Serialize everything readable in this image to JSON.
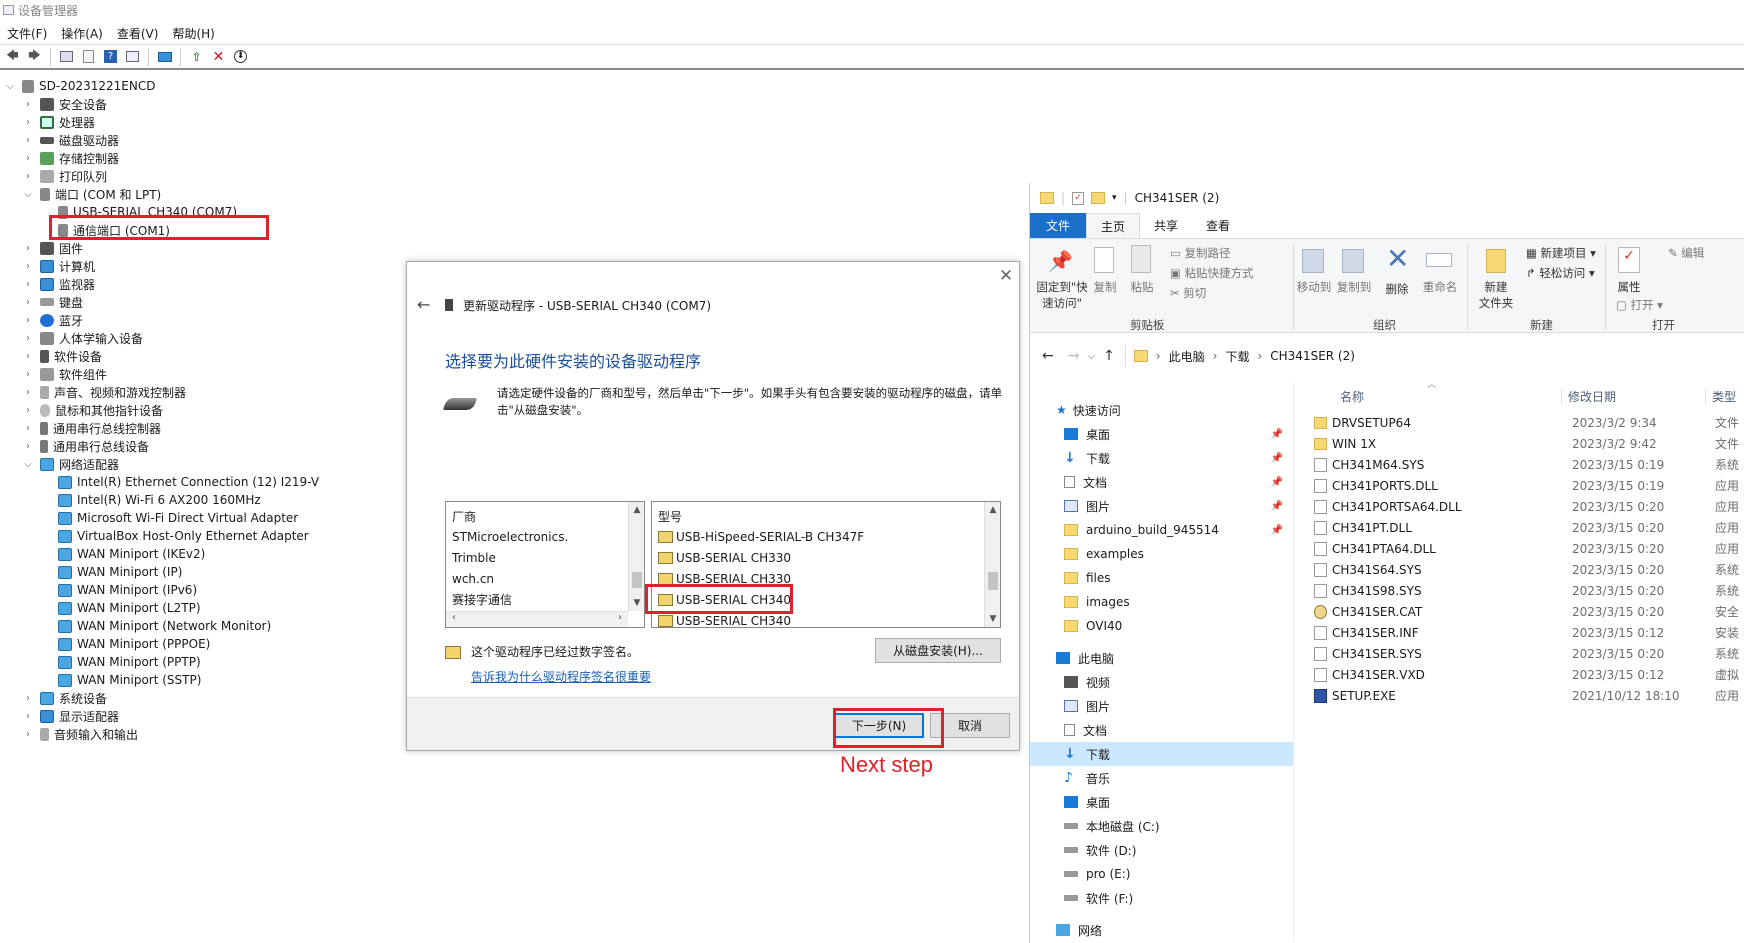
{
  "devmgr": {
    "title": "设备管理器",
    "menu": [
      "文件(F)",
      "操作(A)",
      "查看(V)",
      "帮助(H)"
    ],
    "root": "SD-20231221ENCD",
    "categories_top": [
      "安全设备",
      "处理器",
      "磁盘驱动器",
      "存储控制器",
      "打印队列"
    ],
    "ports_category": "端口 (COM 和 LPT)",
    "ports_children": [
      "USB-SERIAL CH340 (COM7)",
      "通信端口 (COM1)"
    ],
    "categories_mid": [
      "固件",
      "计算机",
      "监视器",
      "键盘",
      "蓝牙",
      "人体学输入设备",
      "软件设备",
      "软件组件",
      "声音、视频和游戏控制器",
      "鼠标和其他指针设备",
      "通用串行总线控制器",
      "通用串行总线设备"
    ],
    "network_category": "网络适配器",
    "network_children": [
      "Intel(R) Ethernet Connection (12) I219-V",
      "Intel(R) Wi-Fi 6 AX200 160MHz",
      "Microsoft Wi-Fi Direct Virtual Adapter",
      "VirtualBox Host-Only Ethernet Adapter",
      "WAN Miniport (IKEv2)",
      "WAN Miniport (IP)",
      "WAN Miniport (IPv6)",
      "WAN Miniport (L2TP)",
      "WAN Miniport (Network Monitor)",
      "WAN Miniport (PPPOE)",
      "WAN Miniport (PPTP)",
      "WAN Miniport (SSTP)"
    ],
    "categories_bottom": [
      "系统设备",
      "显示适配器",
      "音频输入和输出"
    ]
  },
  "dialog": {
    "caption": "更新驱动程序 - USB-SERIAL CH340 (COM7)",
    "heading": "选择要为此硬件安装的设备驱动程序",
    "description": "请选定硬件设备的厂商和型号，然后单击\"下一步\"。如果手头有包含要安装的驱动程序的磁盘，请单击\"从磁盘安装\"。",
    "manufacturer_header": "厂商",
    "manufacturers": [
      "STMicroelectronics.",
      "Trimble",
      "wch.cn",
      "赛接字通信"
    ],
    "model_header": "型号",
    "models": [
      "USB-HiSpeed-SERIAL-B CH347F",
      "USB-SERIAL CH330",
      "USB-SERIAL CH330",
      "USB-SERIAL CH340",
      "USB-SERIAL CH340"
    ],
    "signed_text": "这个驱动程序已经过数字签名。",
    "signing_link": "告诉我为什么驱动程序签名很重要",
    "have_disk": "从磁盘安装(H)...",
    "next": "下一步(N)",
    "cancel": "取消",
    "annotation": "Next step"
  },
  "explorer": {
    "title": "CH341SER (2)",
    "tabs": [
      "文件",
      "主页",
      "共享",
      "查看"
    ],
    "ribbon": {
      "pin": "固定到\"快\n速访问\"",
      "copy": "复制",
      "paste": "粘贴",
      "copy_path": "复制路径",
      "paste_shortcut": "粘贴快捷方式",
      "cut": "剪切",
      "group_clipboard": "剪贴板",
      "move_to": "移动到",
      "copy_to": "复制到",
      "delete": "删除",
      "rename": "重命名",
      "group_organize": "组织",
      "new_folder": "新建\n文件夹",
      "new_item": "新建项目",
      "easy_access": "轻松访问",
      "group_new": "新建",
      "properties": "属性",
      "open": "打开",
      "edit": "编辑",
      "group_open": "打开"
    },
    "path": [
      "此电脑",
      "下载",
      "CH341SER (2)"
    ],
    "nav": {
      "quick_access": "快速访问",
      "quick_items": [
        "桌面",
        "下载",
        "文档",
        "图片",
        "arduino_build_945514",
        "examples",
        "files",
        "images",
        "OVI40"
      ],
      "this_pc": "此电脑",
      "pc_items": [
        "视频",
        "图片",
        "文档",
        "下载",
        "音乐",
        "桌面",
        "本地磁盘 (C:)",
        "软件 (D:)",
        "pro (E:)",
        "软件 (F:)"
      ],
      "network": "网络"
    },
    "columns": [
      "名称",
      "修改日期",
      "类型"
    ],
    "files": [
      {
        "name": "DRVSETUP64",
        "date": "2023/3/2 9:34",
        "type": "文件"
      },
      {
        "name": "WIN 1X",
        "date": "2023/3/2 9:42",
        "type": "文件"
      },
      {
        "name": "CH341M64.SYS",
        "date": "2023/3/15 0:19",
        "type": "系统"
      },
      {
        "name": "CH341PORTS.DLL",
        "date": "2023/3/15 0:19",
        "type": "应用"
      },
      {
        "name": "CH341PORTSA64.DLL",
        "date": "2023/3/15 0:20",
        "type": "应用"
      },
      {
        "name": "CH341PT.DLL",
        "date": "2023/3/15 0:20",
        "type": "应用"
      },
      {
        "name": "CH341PTA64.DLL",
        "date": "2023/3/15 0:20",
        "type": "应用"
      },
      {
        "name": "CH341S64.SYS",
        "date": "2023/3/15 0:20",
        "type": "系统"
      },
      {
        "name": "CH341S98.SYS",
        "date": "2023/3/15 0:20",
        "type": "系统"
      },
      {
        "name": "CH341SER.CAT",
        "date": "2023/3/15 0:20",
        "type": "安全"
      },
      {
        "name": "CH341SER.INF",
        "date": "2023/3/15 0:12",
        "type": "安装"
      },
      {
        "name": "CH341SER.SYS",
        "date": "2023/3/15 0:20",
        "type": "系统"
      },
      {
        "name": "CH341SER.VXD",
        "date": "2023/3/15 0:12",
        "type": "虚拟"
      },
      {
        "name": "SETUP.EXE",
        "date": "2021/10/12 18:10",
        "type": "应用"
      }
    ]
  },
  "colors": {
    "highlight": "#e0202a",
    "link": "#1a5fb4",
    "accent": "#1a6fc8"
  }
}
